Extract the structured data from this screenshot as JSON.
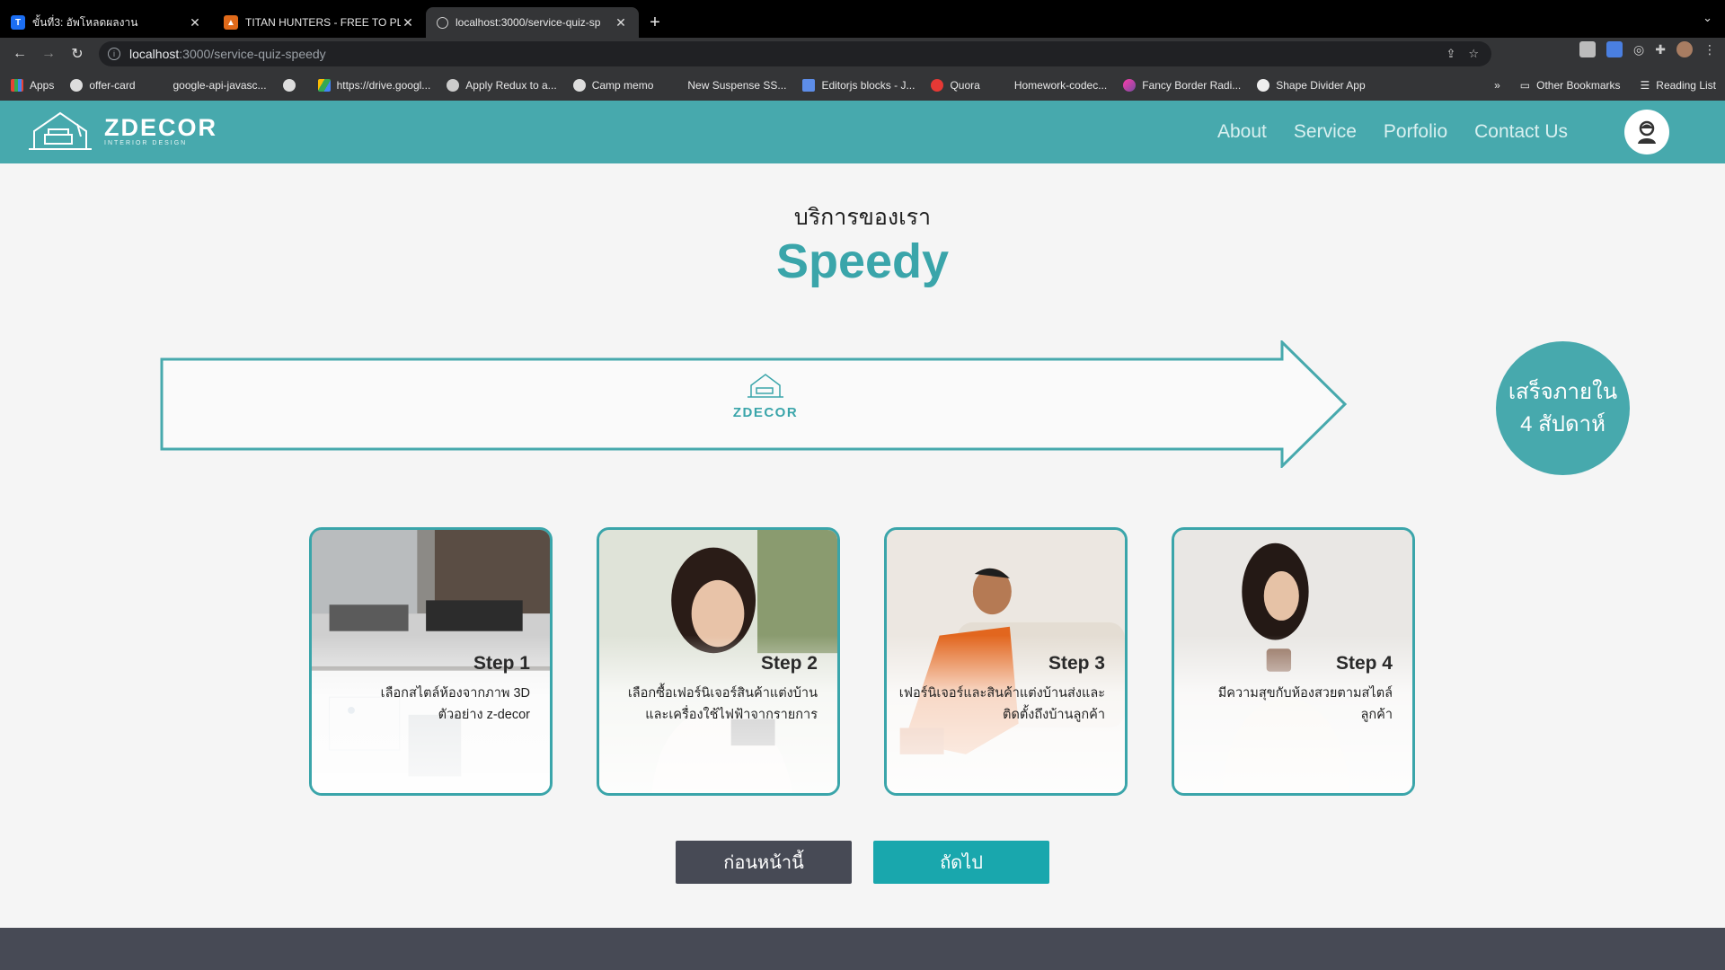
{
  "browser": {
    "tabs": [
      {
        "title": "ขั้นที่3: อัพโหลดผลงาน",
        "active": false
      },
      {
        "title": "TITAN HUNTERS - FREE TO PL",
        "active": false
      },
      {
        "title": "localhost:3000/service-quiz-sp",
        "active": true
      }
    ],
    "new_tab_label": "+",
    "url_host": "localhost",
    "url_rest": ":3000/service-quiz-speedy",
    "bookmarks": [
      "Apps",
      "offer-card",
      "google-api-javasc...",
      "https://drive.googl...",
      "Apply Redux to a...",
      "Camp memo",
      "New Suspense SS...",
      "Editorjs blocks - J...",
      "Quora",
      "Homework-codec...",
      "Fancy Border Radi...",
      "Shape Divider App"
    ],
    "bookmarks_more": "»",
    "other_bookmarks": "Other Bookmarks",
    "reading_list": "Reading List"
  },
  "header": {
    "brand": "ZDECOR",
    "tagline": "INTERIOR DESIGN",
    "nav": [
      "About",
      "Service",
      "Porfolio",
      "Contact Us"
    ]
  },
  "main": {
    "subtitle": "บริการของเรา",
    "title": "Speedy",
    "arrow_logo": "ZDECOR",
    "done_line1": "เสร็จภายใน",
    "done_line2": "4 สัปดาห์",
    "steps": [
      {
        "title": "Step 1",
        "desc1": "เลือกสไตล์ห้องจากภาพ 3D",
        "desc2": "ตัวอย่าง z-decor"
      },
      {
        "title": "Step 2",
        "desc1": "เลือกซื้อเฟอร์นิเจอร์สินค้าแต่งบ้าน",
        "desc2": "และเครื่องใช้ไฟฟ้าจากรายการ"
      },
      {
        "title": "Step 3",
        "desc1": "เฟอร์นิเจอร์และสินค้าแต่งบ้านส่งและ",
        "desc2": "ติดตั้งถึงบ้านลูกค้า"
      },
      {
        "title": "Step 4",
        "desc1": "มีความสุขกับห้องสวยตามสไตล์",
        "desc2": "ลูกค้า"
      }
    ],
    "prev_label": "ก่อนหน้านี้",
    "next_label": "ถัดไป"
  },
  "colors": {
    "accent": "#47a9ad",
    "title": "#3aa5aa",
    "next_button": "#19a7ad",
    "prev_button": "#474a55"
  }
}
